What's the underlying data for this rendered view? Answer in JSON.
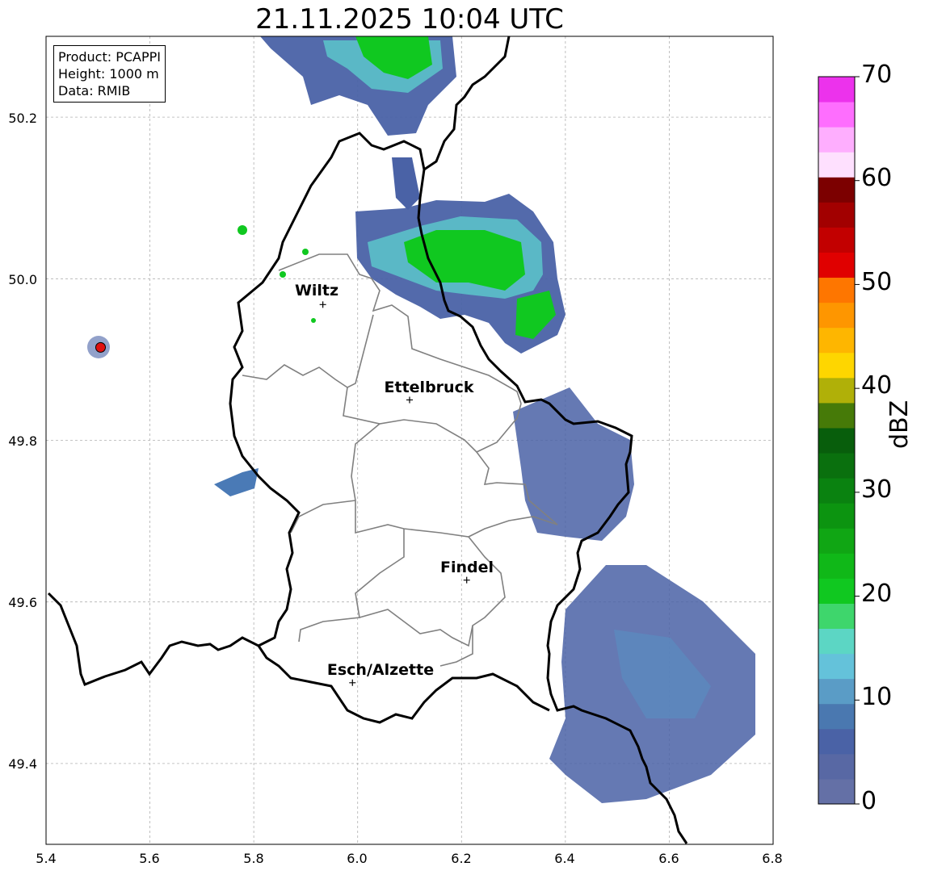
{
  "title": "21.11.2025 10:04 UTC",
  "info_box": {
    "product": "Product: PCAPPI",
    "height": "Height: 1000 m",
    "data": "Data: RMIB"
  },
  "map": {
    "lon_range": [
      5.4,
      6.8
    ],
    "lat_range": [
      49.3,
      50.3
    ],
    "x_ticks": [
      "5.4",
      "5.6",
      "5.8",
      "6.0",
      "6.2",
      "6.4",
      "6.6",
      "6.8"
    ],
    "y_ticks": [
      "49.4",
      "49.6",
      "49.8",
      "50.0",
      "50.2"
    ],
    "grid": true,
    "radar_site": {
      "lon": 5.505,
      "lat": 49.915,
      "color": "#e01010"
    },
    "cities": [
      {
        "name": "Wiltz",
        "lon": 5.933,
        "lat": 49.968
      },
      {
        "name": "Ettelbruck",
        "lon": 6.1,
        "lat": 49.85
      },
      {
        "name": "Findel",
        "lon": 6.21,
        "lat": 49.627
      },
      {
        "name": "Esch/Alzette",
        "lon": 5.99,
        "lat": 49.5
      }
    ]
  },
  "colorbar": {
    "label": "dBZ",
    "min": 0,
    "max": 70,
    "ticks": [
      "0",
      "10",
      "20",
      "30",
      "40",
      "50",
      "60",
      "70"
    ],
    "colors": [
      "#6470a6",
      "#5868a4",
      "#4a62a6",
      "#4a78b0",
      "#5a9cc6",
      "#64c2da",
      "#5cd6c4",
      "#3ed66c",
      "#10c820",
      "#10b818",
      "#10a614",
      "#0c9410",
      "#0a8210",
      "#0a700e",
      "#085e0c",
      "#467a08",
      "#b0b008",
      "#fed600",
      "#feb600",
      "#fe9600",
      "#fe7600",
      "#e00000",
      "#c20000",
      "#a20000",
      "#7c0000",
      "#fee0fe",
      "#feaefe",
      "#fe6efe",
      "#ec32ec"
    ]
  }
}
